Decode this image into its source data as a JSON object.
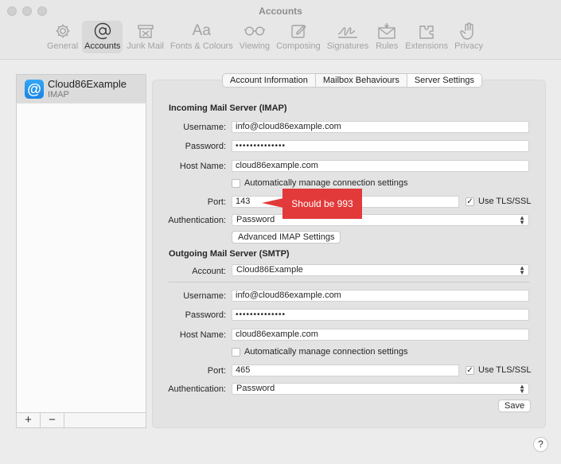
{
  "window": {
    "title": "Accounts"
  },
  "toolbar": {
    "items": [
      {
        "label": "General",
        "icon": "gear-icon"
      },
      {
        "label": "Accounts",
        "icon": "at-sign-icon"
      },
      {
        "label": "Junk Mail",
        "icon": "junk-mail-icon"
      },
      {
        "label": "Fonts & Colours",
        "icon": "fonts-icon"
      },
      {
        "label": "Viewing",
        "icon": "glasses-icon"
      },
      {
        "label": "Composing",
        "icon": "compose-icon"
      },
      {
        "label": "Signatures",
        "icon": "signature-icon"
      },
      {
        "label": "Rules",
        "icon": "rules-envelope-icon"
      },
      {
        "label": "Extensions",
        "icon": "extensions-icon"
      },
      {
        "label": "Privacy",
        "icon": "hand-icon"
      }
    ],
    "selected": "Accounts"
  },
  "sidebar": {
    "accounts": [
      {
        "name": "Cloud86Example",
        "type": "IMAP"
      }
    ],
    "add_label": "+",
    "remove_label": "−"
  },
  "tabs": [
    {
      "label": "Account Information"
    },
    {
      "label": "Mailbox Behaviours"
    },
    {
      "label": "Server Settings"
    }
  ],
  "selected_tab": "Server Settings",
  "incoming": {
    "section_title": "Incoming Mail Server (IMAP)",
    "username_label": "Username:",
    "username": "info@cloud86example.com",
    "password_label": "Password:",
    "password": "••••••••••••••",
    "host_label": "Host Name:",
    "host": "cloud86example.com",
    "auto_manage_label": "Automatically manage connection settings",
    "auto_manage_checked": false,
    "port_label": "Port:",
    "port": "143",
    "tls_label": "Use TLS/SSL",
    "tls_checked": true,
    "auth_label": "Authentication:",
    "auth": "Password",
    "advanced_button": "Advanced IMAP Settings"
  },
  "annotation": {
    "text": "Should be 993",
    "color": "#e23a3a"
  },
  "outgoing": {
    "section_title": "Outgoing Mail Server (SMTP)",
    "account_label": "Account:",
    "account": "Cloud86Example",
    "username_label": "Username:",
    "username": "info@cloud86example.com",
    "password_label": "Password:",
    "password": "••••••••••••••",
    "host_label": "Host Name:",
    "host": "cloud86example.com",
    "auto_manage_label": "Automatically manage connection settings",
    "auto_manage_checked": false,
    "port_label": "Port:",
    "port": "465",
    "tls_label": "Use TLS/SSL",
    "tls_checked": true,
    "auth_label": "Authentication:",
    "auth": "Password"
  },
  "save_button": "Save",
  "help_label": "?"
}
